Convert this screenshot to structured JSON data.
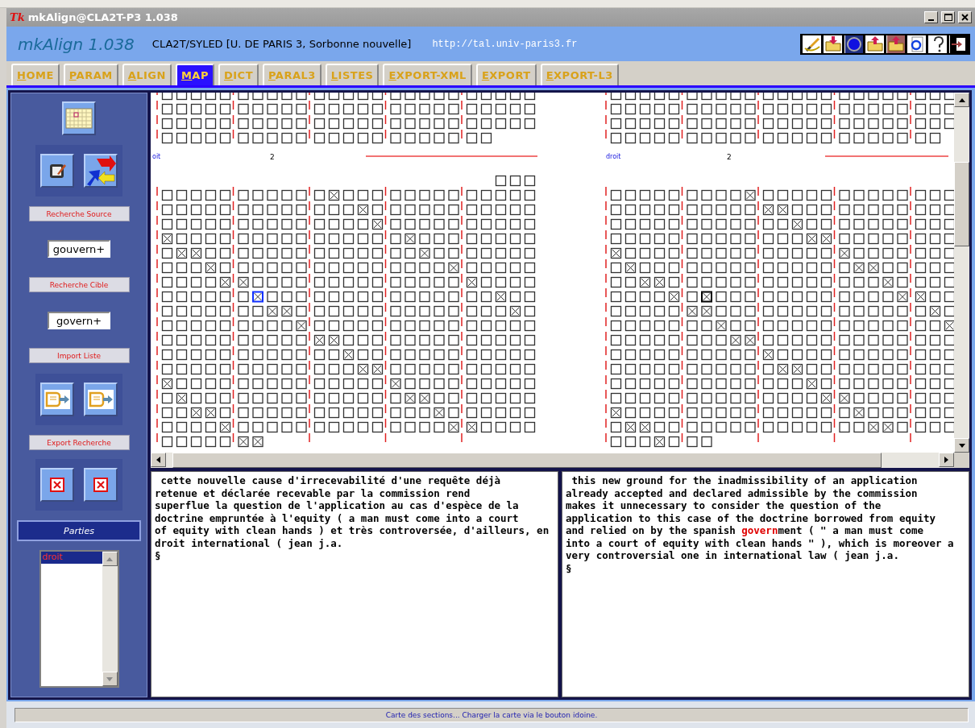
{
  "window": {
    "title": "mkAlign@CLA2T-P3 1.038",
    "icon_text": "Tk"
  },
  "header": {
    "app_name": "mkAlign 1.038",
    "institution": "CLA2T/SYLED [U. DE PARIS 3, Sorbonne nouvelle]",
    "url": "http://tal.univ-paris3.fr"
  },
  "tabs": [
    {
      "label": "HOME",
      "selected": false
    },
    {
      "label": "PARAM",
      "selected": false
    },
    {
      "label": "ALIGN",
      "selected": false
    },
    {
      "label": "MAP",
      "selected": true
    },
    {
      "label": "DICT",
      "selected": false
    },
    {
      "label": "PARAL3",
      "selected": false
    },
    {
      "label": "LISTES",
      "selected": false
    },
    {
      "label": "EXPORT-XML",
      "selected": false
    },
    {
      "label": "EXPORT",
      "selected": false
    },
    {
      "label": "EXPORT-L3",
      "selected": false
    }
  ],
  "sidebar": {
    "source_search_label": "Recherche Source",
    "source_search_value": "gouvern+",
    "target_search_label": "Recherche Cible",
    "target_search_value": "govern+",
    "import_label": "Import Liste",
    "export_label": "Export Recherche",
    "parties_title": "Parties",
    "parties": [
      {
        "label": "droit",
        "selected": true
      }
    ]
  },
  "map": {
    "left_label": "oit",
    "left_section": "2",
    "right_label": "droit",
    "right_section": "2"
  },
  "source_text": {
    "lines": [
      " cette nouvelle cause d'irrecevabilité d'une requête déjà",
      "retenue et déclarée recevable par la commission rend",
      "superflue la question de l'application au cas d'espèce de la",
      "doctrine empruntée à l'equity ( a man must come into a court",
      "of equity with clean hands ) et très controversée, d'ailleurs, en",
      "droit international ( jean j.a."
    ],
    "end_mark": "§"
  },
  "target_text": {
    "lines": [
      " this new ground for the inadmissibility of an application",
      "already accepted and declared admissible by the commission",
      "makes it unnecessary to consider the question of the",
      "application to this case of the doctrine borrowed from equity",
      {
        "parts": [
          {
            "text": "and relied on by the spanish ",
            "highlight": false
          },
          {
            "text": "govern",
            "highlight": true
          },
          {
            "text": "ment ( \" a man must come",
            "highlight": false
          }
        ]
      },
      "into a court of equity with clean hands \" ), which is moreover a",
      "very controversial one in international law ( jean j.a."
    ],
    "end_mark": "§"
  },
  "status_bar": "Carte des sections... Charger la carte via le bouton idoine."
}
